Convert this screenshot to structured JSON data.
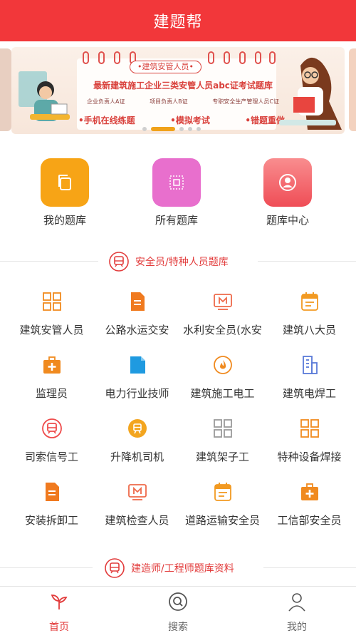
{
  "header": {
    "title": "建题帮"
  },
  "banner": {
    "tag": "•建筑安管人员•",
    "headline": "最新建筑施工企业三类安管人员abc证考试题库",
    "subtitles": [
      "企业负责人A证",
      "项目负责人B证",
      "专职安全生产管理人员C证"
    ],
    "features": [
      "•手机在线练题",
      "•模拟考试",
      "•错题重做"
    ],
    "dots": 5,
    "active_dot": 1
  },
  "quick_actions": [
    {
      "label": "我的题库",
      "color": "#f7a416",
      "icon": "copy-icon"
    },
    {
      "label": "所有题库",
      "color": "#e86fcd",
      "icon": "frame-icon"
    },
    {
      "label": "题库中心",
      "color": "#f0565c",
      "icon": "user-circle-icon"
    }
  ],
  "section1": {
    "title": "安全员/特种人员题库"
  },
  "grid_items": [
    {
      "label": "建筑安管人员",
      "icon": "grid-icon",
      "color": "#f08a1f"
    },
    {
      "label": "公路水运交安",
      "icon": "document-icon",
      "color": "#f07a1f"
    },
    {
      "label": "水利安全员(水安",
      "icon": "monitor-icon",
      "color": "#ee6a4a"
    },
    {
      "label": "建筑八大员",
      "icon": "calendar-icon",
      "color": "#f29a22"
    },
    {
      "label": "监理员",
      "icon": "medkit-icon",
      "color": "#f08a1f"
    },
    {
      "label": "电力行业技师",
      "icon": "file-icon",
      "color": "#1f9ae0"
    },
    {
      "label": "建筑施工电工",
      "icon": "fire-icon",
      "color": "#f08a1f"
    },
    {
      "label": "建筑电焊工",
      "icon": "building-icon",
      "color": "#5a7ad8"
    },
    {
      "label": "司索信号工",
      "icon": "train-icon",
      "color": "#ee4b4b"
    },
    {
      "label": "升降机司机",
      "icon": "coin-icon",
      "color": "#f3a51f"
    },
    {
      "label": "建筑架子工",
      "icon": "grid-icon",
      "color": "#9a9a9a"
    },
    {
      "label": "特种设备焊接",
      "icon": "grid-icon",
      "color": "#f08a1f"
    },
    {
      "label": "安装拆卸工",
      "icon": "document-icon",
      "color": "#f07a1f"
    },
    {
      "label": "建筑检查人员",
      "icon": "monitor-icon",
      "color": "#ee6a4a"
    },
    {
      "label": "道路运输安全员",
      "icon": "calendar-icon",
      "color": "#f29a22"
    },
    {
      "label": "工信部安全员",
      "icon": "medkit-icon",
      "color": "#f08a1f"
    }
  ],
  "section2": {
    "title": "建造师/工程师题库资料"
  },
  "tabs": [
    {
      "label": "首页",
      "icon": "sprout-icon",
      "active": true
    },
    {
      "label": "搜索",
      "icon": "search-icon",
      "active": false
    },
    {
      "label": "我的",
      "icon": "user-icon",
      "active": false
    }
  ],
  "colors": {
    "brand": "#f2373a",
    "section_text": "#e23b3b",
    "active_dot": "#f0a21a"
  }
}
